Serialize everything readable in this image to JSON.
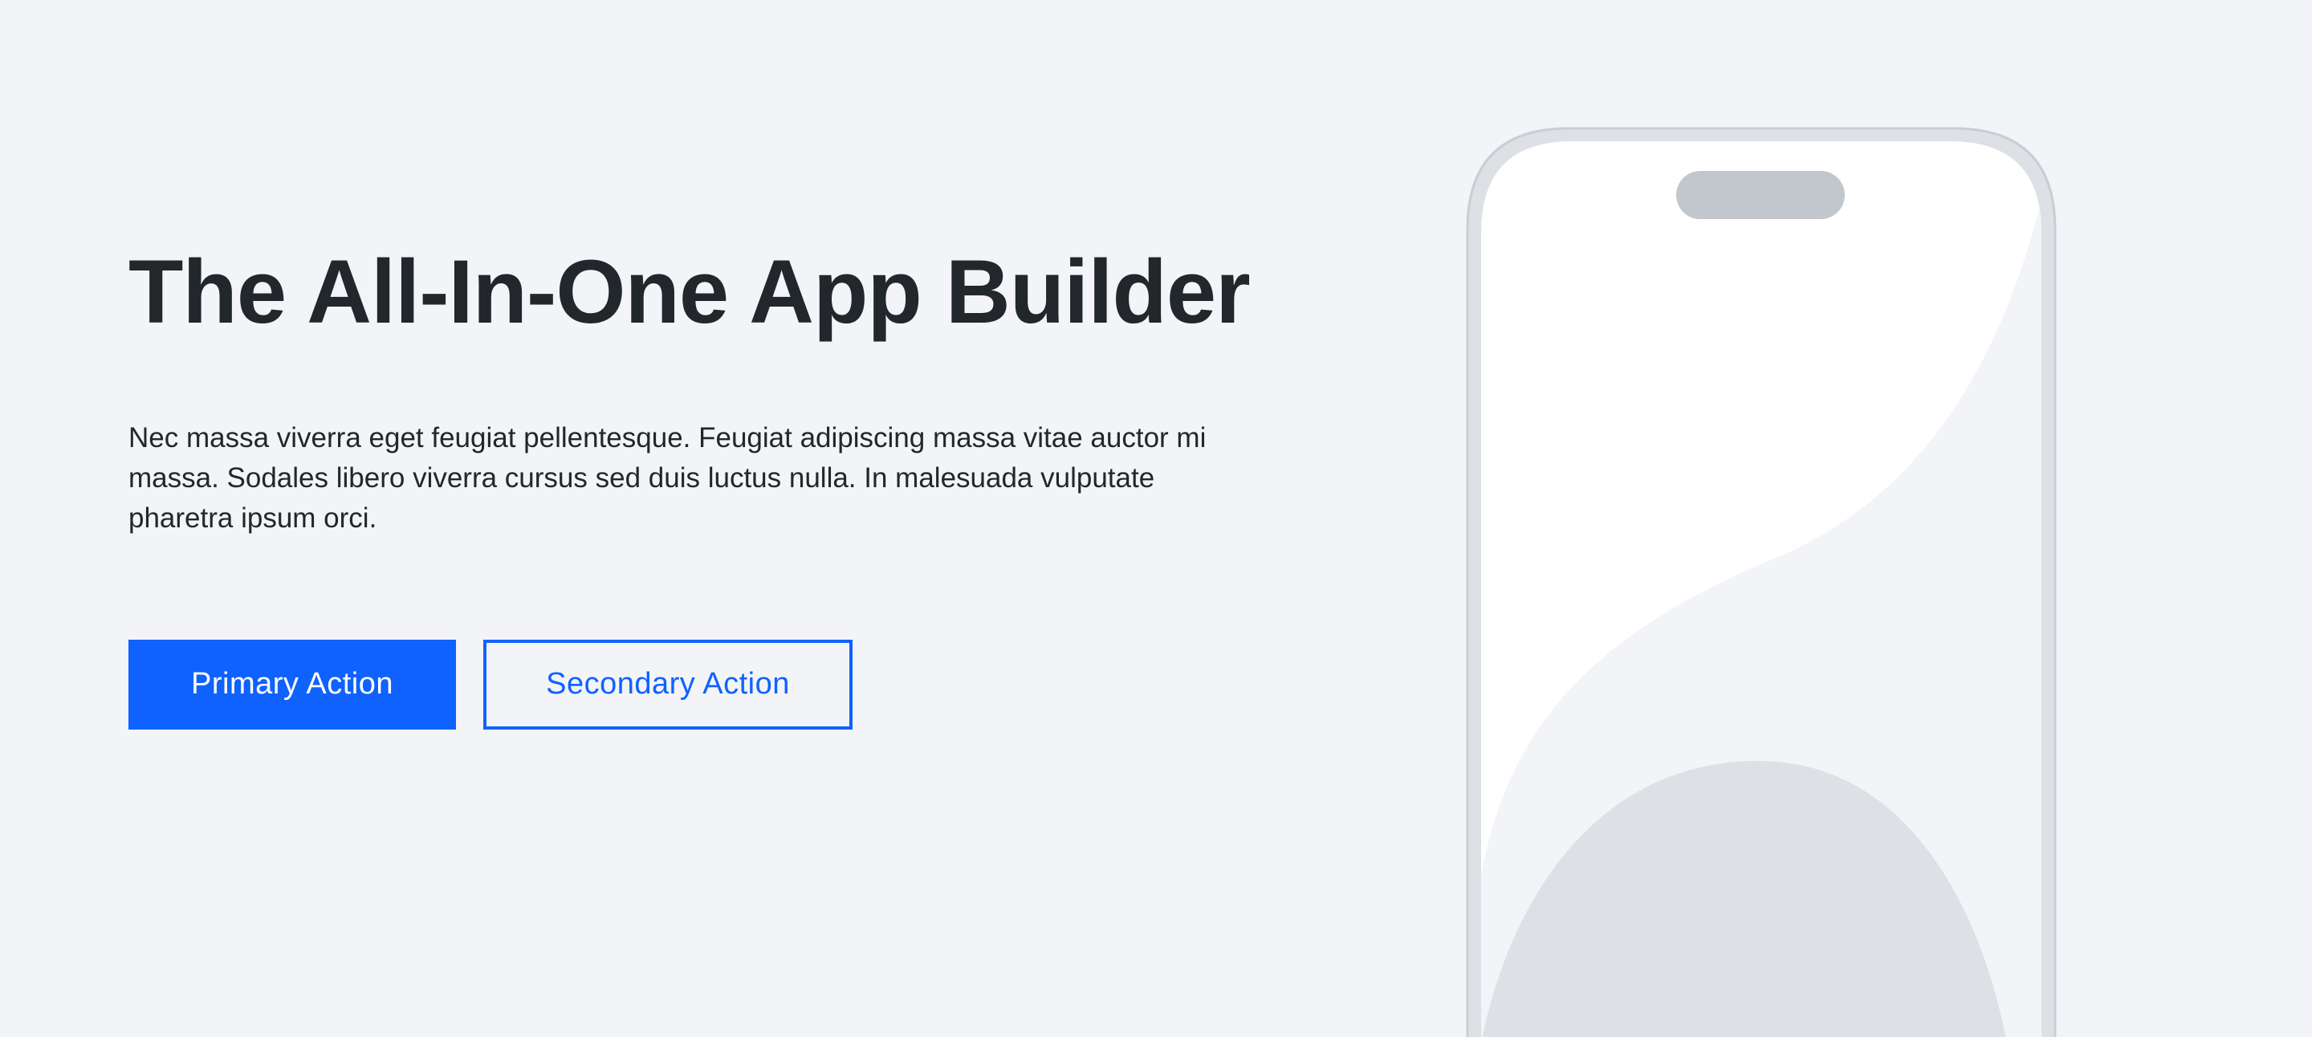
{
  "hero": {
    "headline": "The All-In-One App Builder",
    "body": "Nec massa viverra eget feugiat pellentesque. Feugiat adipiscing massa vitae auctor mi massa. Sodales libero viverra cursus sed duis luctus nulla. In malesuada vulputate pharetra ipsum orci.",
    "primary_action_label": "Primary Action",
    "secondary_action_label": "Secondary Action"
  },
  "colors": {
    "background": "#f2f4f8",
    "text": "#21272a",
    "accent": "#0f62fe",
    "phone_frame": "#dde1e6",
    "phone_notch": "#c1c7cd",
    "phone_screen": "#ffffff",
    "phone_shape_dark": "#dde1e6"
  }
}
